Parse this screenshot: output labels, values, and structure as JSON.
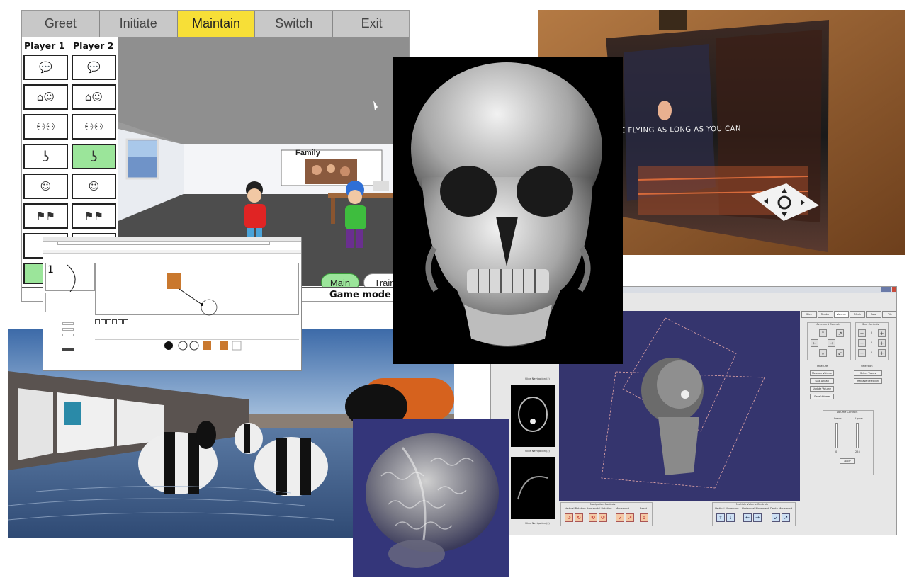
{
  "collage": {
    "game_app": {
      "tabs": [
        {
          "label": "Greet",
          "active": false
        },
        {
          "label": "Initiate",
          "active": false
        },
        {
          "label": "Maintain",
          "active": true
        },
        {
          "label": "Switch",
          "active": false
        },
        {
          "label": "Exit",
          "active": false
        }
      ],
      "player1_header": "Player 1",
      "player2_header": "Player 2",
      "card_icons": [
        "chat-bubble",
        "house-person",
        "two-people",
        "ear",
        "smiley-face",
        "finish-flag"
      ],
      "highlight_color": "#9be59a",
      "active_tab_color": "#f7df37",
      "scene": {
        "poster_title": "Family",
        "buttons": {
          "main_label": "Main",
          "training_label": "Trainin"
        }
      },
      "mode_label": "Game mode"
    },
    "display_photo": {
      "screen_text": "E FLYING AS LONG AS YOU CAN"
    },
    "browser_editor": {
      "canvas_digit": "1"
    },
    "medical_app": {
      "tabs": [
        "Slice",
        "Render",
        "Volume",
        "Mesh",
        "Color",
        "File"
      ],
      "view_label": "Slice Navigation (z)",
      "movement_header": "Movement Controls",
      "size_header": "Size Controls",
      "size_values": [
        "2",
        "1",
        "1"
      ],
      "measure_header": "Measure",
      "measure_buttons": [
        "Measure Volume",
        "Slab Ahead",
        "Update Volume",
        "Save Volume"
      ],
      "selection_header": "Selection",
      "selection_buttons": [
        "Select Voxels",
        "Release Selection"
      ],
      "volume_header": "Volume Controls",
      "volume_cols": [
        "Lower",
        "Upper"
      ],
      "volume_values": [
        "0",
        "255"
      ],
      "apply_label": "apply",
      "navigation_header": "Navigation Controls",
      "navigation_groups": [
        "Vertical Rotation",
        "Horizontal Rotation",
        "Movement",
        "Reset"
      ],
      "multiview_header": "Multiple Volume Controls",
      "multiview_groups": [
        "Vertical Movement",
        "Horizontal Movement",
        "Depth Movement"
      ]
    }
  }
}
